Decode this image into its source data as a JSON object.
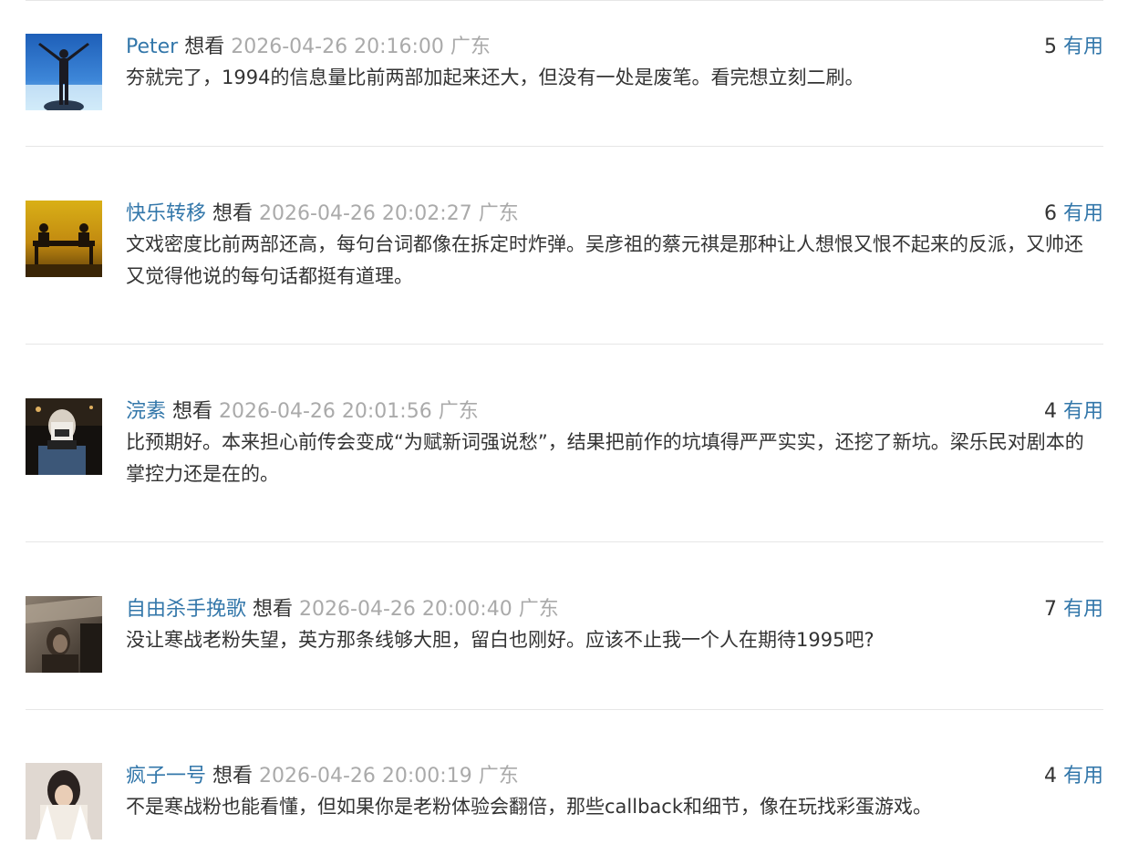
{
  "comments": [
    {
      "user": "Peter",
      "status": "想看",
      "time": "2026-04-26 20:16:00",
      "location": "广东",
      "votes": "5",
      "vote_label": "有用",
      "text": "夯就完了，1994的信息量比前两部加起来还大，但没有一处是废笔。看完想立刻二刷。"
    },
    {
      "user": "快乐转移",
      "status": "想看",
      "time": "2026-04-26 20:02:27",
      "location": "广东",
      "votes": "6",
      "vote_label": "有用",
      "text": "文戏密度比前两部还高，每句台词都像在拆定时炸弹。吴彦祖的蔡元祺是那种让人想恨又恨不起来的反派，又帅还又觉得他说的每句话都挺有道理。"
    },
    {
      "user": "浣素",
      "status": "想看",
      "time": "2026-04-26 20:01:56",
      "location": "广东",
      "votes": "4",
      "vote_label": "有用",
      "text": "比预期好。本来担心前传会变成“为赋新词强说愁”，结果把前作的坑填得严严实实，还挖了新坑。梁乐民对剧本的掌控力还是在的。"
    },
    {
      "user": "自由杀手挽歌",
      "status": "想看",
      "time": "2026-04-26 20:00:40",
      "location": "广东",
      "votes": "7",
      "vote_label": "有用",
      "text": "没让寒战老粉失望，英方那条线够大胆，留白也刚好。应该不止我一个人在期待1995吧?"
    },
    {
      "user": "疯子一号",
      "status": "想看",
      "time": "2026-04-26 20:00:19",
      "location": "广东",
      "votes": "4",
      "vote_label": "有用",
      "text": "不是寒战粉也能看懂，但如果你是老粉体验会翻倍，那些callback和细节，像在玩找彩蛋游戏。"
    }
  ]
}
